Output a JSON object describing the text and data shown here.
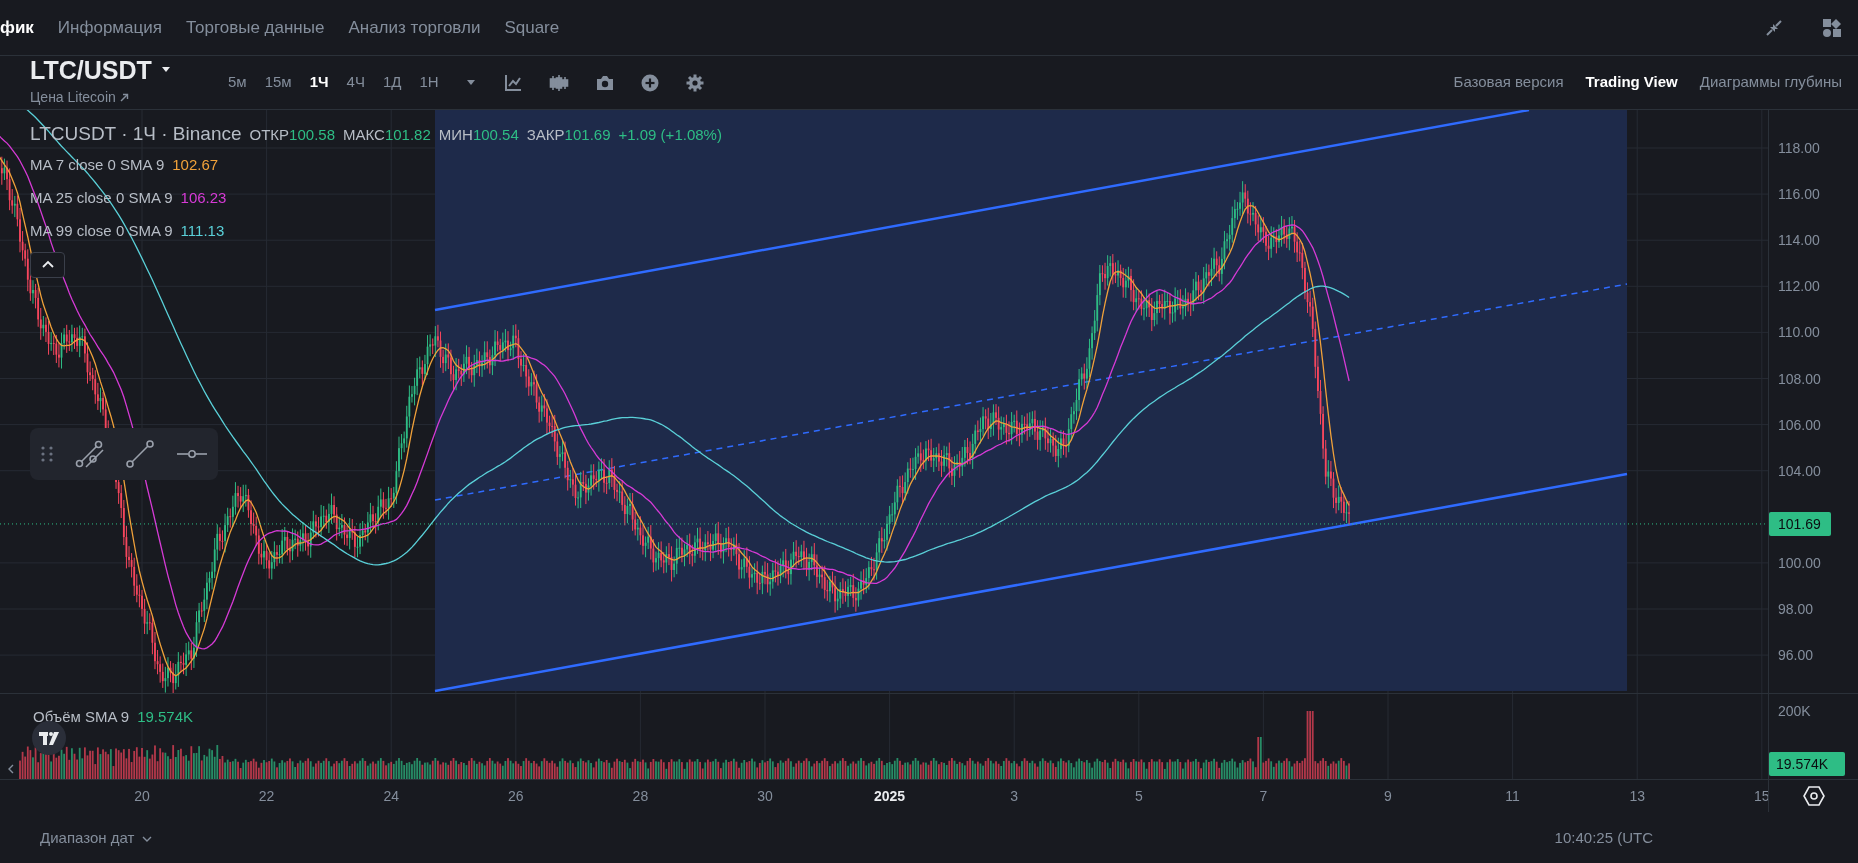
{
  "top_nav": {
    "tabs": [
      {
        "label": "фик",
        "selected": true
      },
      {
        "label": "Информация",
        "selected": false
      },
      {
        "label": "Торговые данные",
        "selected": false
      },
      {
        "label": "Анализ торговли",
        "selected": false
      },
      {
        "label": "Square",
        "selected": false
      }
    ]
  },
  "symbol": {
    "title": "LTC/USDT",
    "subtitle": "Цена Litecoin"
  },
  "intervals": [
    {
      "label": "5м",
      "selected": false
    },
    {
      "label": "15м",
      "selected": false
    },
    {
      "label": "1Ч",
      "selected": true
    },
    {
      "label": "4Ч",
      "selected": false
    },
    {
      "label": "1Д",
      "selected": false
    },
    {
      "label": "1Н",
      "selected": false
    }
  ],
  "view_modes": [
    {
      "label": "Базовая версия",
      "selected": false
    },
    {
      "label": "Trading View",
      "selected": true
    },
    {
      "label": "Диаграммы глубины",
      "selected": false
    }
  ],
  "legend": {
    "title": "LTCUSDT · 1Ч · Binance",
    "ohlc": [
      {
        "label": "ОТКР",
        "value": "100.58"
      },
      {
        "label": "МАКС",
        "value": "101.82"
      },
      {
        "label": "МИН",
        "value": "100.54"
      },
      {
        "label": "ЗАКР",
        "value": "101.69"
      }
    ],
    "change": "+1.09 (+1.08%)"
  },
  "moving_averages": [
    {
      "label": "MA 7 close 0 SMA 9",
      "value": "102.67",
      "color": "#f0a13a"
    },
    {
      "label": "MA 25 close 0 SMA 9",
      "value": "106.23",
      "color": "#d63ad6"
    },
    {
      "label": "MA 99 close 0 SMA 9",
      "value": "111.13",
      "color": "#5ad0d8"
    }
  ],
  "price_axis": {
    "labels": [
      "118.00",
      "116.00",
      "114.00",
      "112.00",
      "110.00",
      "108.00",
      "106.00",
      "104.00",
      "100.00",
      "98.00",
      "96.00"
    ],
    "last_price": "101.69"
  },
  "volume": {
    "label": "Объём SMA 9",
    "value": "19.574K",
    "axis_label": "200K",
    "last_value": "19.574K"
  },
  "time_axis": {
    "labels": [
      {
        "label": "20",
        "kind": "day"
      },
      {
        "label": "22",
        "kind": "day"
      },
      {
        "label": "24",
        "kind": "day"
      },
      {
        "label": "26",
        "kind": "day"
      },
      {
        "label": "28",
        "kind": "day"
      },
      {
        "label": "30",
        "kind": "day"
      },
      {
        "label": "2025",
        "kind": "year"
      },
      {
        "label": "3",
        "kind": "day"
      },
      {
        "label": "5",
        "kind": "day"
      },
      {
        "label": "7",
        "kind": "day"
      },
      {
        "label": "9",
        "kind": "day"
      },
      {
        "label": "11",
        "kind": "day"
      },
      {
        "label": "13",
        "kind": "day"
      },
      {
        "label": "15",
        "kind": "day"
      }
    ]
  },
  "bottom_bar": {
    "date_range": "Диапазон дат",
    "clock": "10:40:25 (UTC"
  }
}
